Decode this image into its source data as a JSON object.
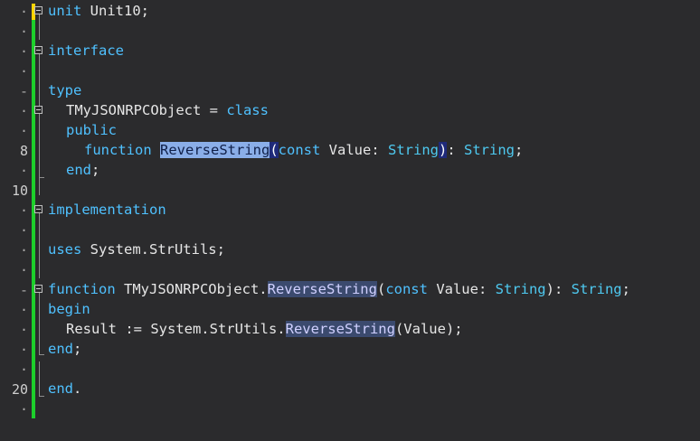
{
  "gutter": {
    "markers": [
      {
        "row": 0,
        "text": "·"
      },
      {
        "row": 1,
        "text": "·"
      },
      {
        "row": 2,
        "text": "·"
      },
      {
        "row": 3,
        "text": "·"
      },
      {
        "row": 4,
        "text": "-"
      },
      {
        "row": 5,
        "text": "·"
      },
      {
        "row": 6,
        "text": "·"
      },
      {
        "row": 7,
        "text": "8"
      },
      {
        "row": 8,
        "text": "·"
      },
      {
        "row": 9,
        "text": "10"
      },
      {
        "row": 10,
        "text": "·"
      },
      {
        "row": 11,
        "text": "·"
      },
      {
        "row": 12,
        "text": "·"
      },
      {
        "row": 13,
        "text": "·"
      },
      {
        "row": 14,
        "text": "-"
      },
      {
        "row": 15,
        "text": "·"
      },
      {
        "row": 16,
        "text": "·"
      },
      {
        "row": 17,
        "text": "·"
      },
      {
        "row": 18,
        "text": "·"
      },
      {
        "row": 19,
        "text": "20"
      },
      {
        "row": 20,
        "text": "·"
      }
    ]
  },
  "code": {
    "l0": {
      "kw": "unit",
      "rest": " Unit10;"
    },
    "l2": {
      "kw": "interface"
    },
    "l4": {
      "kw": "type"
    },
    "l5": {
      "id": "TMyJSONRPCObject",
      "eq": " = ",
      "kw": "class"
    },
    "l6": {
      "kw": "public"
    },
    "l7": {
      "kw": "function",
      "sel": "ReverseString",
      "lparen": "(",
      "kconst": "const",
      "param": " Value: ",
      "ty": "String",
      "rparen": ")",
      "colon": ": ",
      "ret": "String",
      "semi": ";"
    },
    "l8": {
      "kw": "end",
      "semi": ";"
    },
    "l10": {
      "kw": "implementation"
    },
    "l12": {
      "kw": "uses",
      "rest": " System.StrUtils;"
    },
    "l14": {
      "kw": "function",
      "cls": " TMyJSONRPCObject.",
      "mth": "ReverseString",
      "lparen": "(",
      "kconst": "const",
      "param": " Value: ",
      "ty": "String",
      "rparen": "): ",
      "ret": "String",
      "semi": ";"
    },
    "l15": {
      "kw": "begin"
    },
    "l16": {
      "pre": "Result := System.StrUtils.",
      "mth": "ReverseString",
      "post": "(Value);"
    },
    "l17": {
      "kw": "end",
      "semi": ";"
    },
    "l19": {
      "kw": "end",
      "dot": "."
    }
  },
  "colors": {
    "background": "#2b2b2d",
    "keyword": "#4fc1ff",
    "change_bar": "#1dcf2b",
    "selection": "#8aaee8"
  }
}
